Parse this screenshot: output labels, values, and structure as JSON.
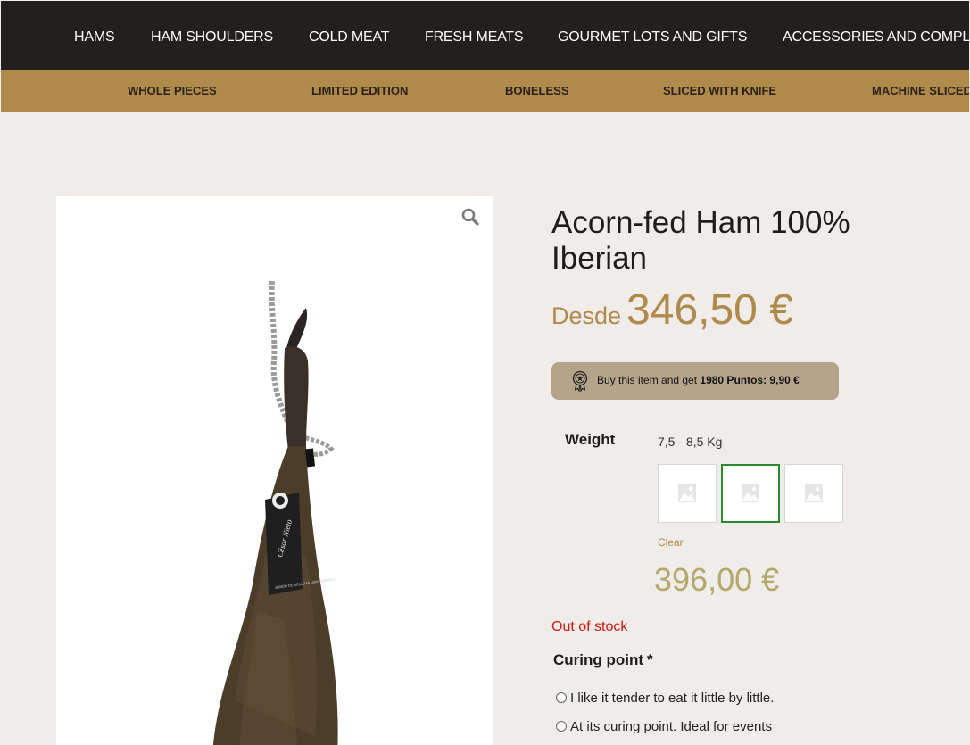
{
  "top_nav": [
    "HAMS",
    "HAM SHOULDERS",
    "COLD MEAT",
    "FRESH MEATS",
    "GOURMET LOTS AND GIFTS",
    "ACCESSORIES AND COMPL"
  ],
  "sub_nav": [
    "WHOLE PIECES",
    "LIMITED EDITION",
    "BONELESS",
    "SLICED WITH KNIFE",
    "MACHINE SLICED"
  ],
  "product": {
    "title": "Acorn-fed Ham 100% Iberian",
    "price_from_label": "Desde",
    "price_from": "346,50 €",
    "points_text_before": "Buy this item and get ",
    "points_text_bold": "1980 Puntos: 9,90 €",
    "weight_label": "Weight",
    "weight_value": "7,5 - 8,5 Kg",
    "swatches": [
      "option-1",
      "option-2",
      "option-3"
    ],
    "selected_swatch": 1,
    "clear_label": "Clear",
    "variation_price": "396,00 €",
    "stock_status": "Out of stock",
    "curing_label": "Curing point",
    "curing_required": "*",
    "curing_options": [
      "I like it tender to eat it little by little.",
      "At its curing point. Ideal for events"
    ],
    "label_brand": "César Nieto",
    "label_subtext": "JAMÓN DE BELLOTA 100% IBÉRICO"
  },
  "colors": {
    "topnav_bg": "#231f1e",
    "subnav_bg": "#b08a4a",
    "page_bg": "#efece9",
    "accent": "#b08a4a",
    "points_bg": "#b4a58a",
    "variation_price": "#b3a96a",
    "out_of_stock": "#d11a0e",
    "selected_border": "#2a8a2a"
  },
  "icons": [
    "search-icon",
    "medal-icon",
    "image-placeholder-icon",
    "radio-icon"
  ]
}
